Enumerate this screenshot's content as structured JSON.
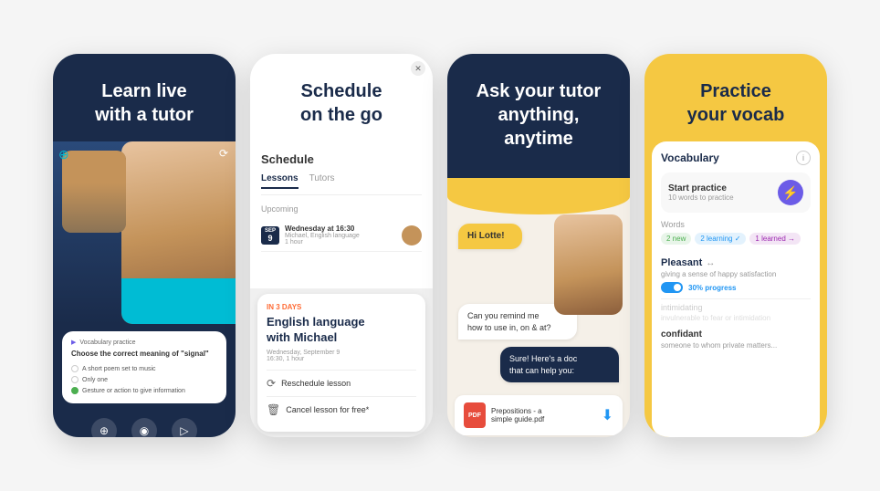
{
  "cards": [
    {
      "id": "card1",
      "headline": "Learn live\nwith a tutor",
      "quiz": {
        "title": "Vocabulary practice",
        "question": "Choose the correct meaning of \"signal\"",
        "options": [
          {
            "text": "A short poem set to music",
            "correct": false
          },
          {
            "text": "Only one",
            "correct": false
          },
          {
            "text": "Gesture or action to give information",
            "correct": true
          }
        ]
      },
      "bottomIcons": [
        "⊕",
        "◉",
        "▶"
      ]
    },
    {
      "id": "card2",
      "headline": "Schedule\non the go",
      "schedule": {
        "title": "Schedule",
        "tabs": [
          "Lessons",
          "Tutors"
        ],
        "activeTab": "Lessons",
        "upcoming_label": "Upcoming",
        "lesson": {
          "dateBadge": "SEP\n9",
          "day": "Wednesday at 16:30",
          "sub": "Michael, English language\n1 hour"
        },
        "in3days": {
          "label": "IN 3 DAYS",
          "title": "English language\nwith Michael",
          "sub": "Wednesday, September 9\n16:30, 1 hour"
        },
        "actions": [
          {
            "icon": "⟳",
            "label": "Reschedule lesson"
          },
          {
            "icon": "🗑",
            "label": "Cancel lesson for free*"
          }
        ]
      }
    },
    {
      "id": "card3",
      "headline": "Ask your tutor\nanything, anytime",
      "chat": {
        "greeting": "Hi Lotte!",
        "question": "Can you remind me\nhow to use in, on & at?",
        "answer": "Sure! Here's a doc\nthat can help you:",
        "pdf": {
          "name": "Prepositions - a\nsimple guide.pdf",
          "label": "PDF"
        }
      }
    },
    {
      "id": "card4",
      "headline": "Practice\nyour vocab",
      "vocab": {
        "title": "Vocabulary",
        "startPractice": {
          "label": "Start practice",
          "sub": "10 words to practice"
        },
        "wordsLabel": "Words",
        "tags": [
          {
            "label": "2 new",
            "type": "new"
          },
          {
            "label": "2 learning ✓",
            "type": "learning"
          },
          {
            "label": "1 learned →",
            "type": "learned"
          }
        ],
        "words": [
          {
            "name": "Pleasant",
            "icon": "↔",
            "definition": "giving a sense of happy satisfaction",
            "progress": "30% progress"
          },
          {
            "name": "intimidating",
            "definition": "invulnerable to fear or intimidation"
          },
          {
            "name": "confidant",
            "definition": "someone to whom private matters..."
          }
        ]
      }
    }
  ]
}
